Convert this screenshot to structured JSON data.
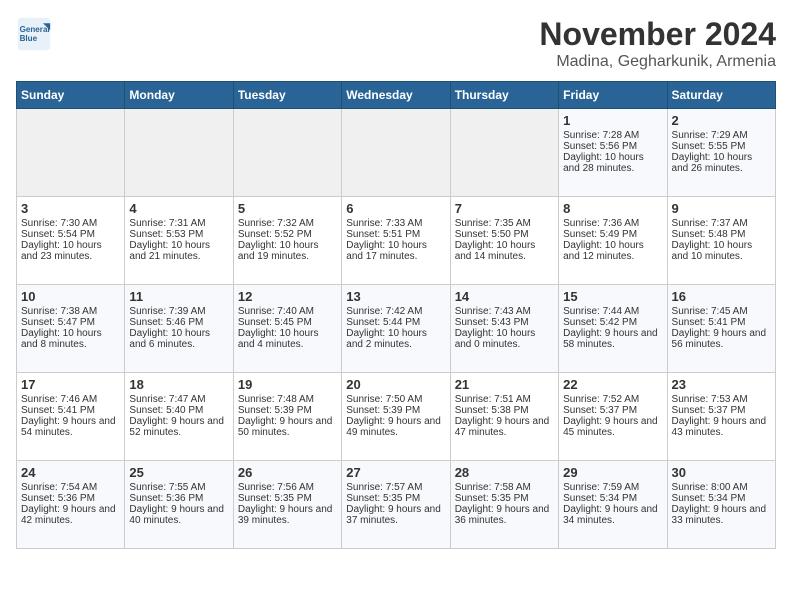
{
  "header": {
    "logo_line1": "General",
    "logo_line2": "Blue",
    "month_year": "November 2024",
    "location": "Madina, Gegharkunik, Armenia"
  },
  "weekdays": [
    "Sunday",
    "Monday",
    "Tuesday",
    "Wednesday",
    "Thursday",
    "Friday",
    "Saturday"
  ],
  "weeks": [
    [
      {
        "day": "",
        "empty": true
      },
      {
        "day": "",
        "empty": true
      },
      {
        "day": "",
        "empty": true
      },
      {
        "day": "",
        "empty": true
      },
      {
        "day": "",
        "empty": true
      },
      {
        "day": "1",
        "sunrise": "7:28 AM",
        "sunset": "5:56 PM",
        "daylight": "10 hours and 28 minutes."
      },
      {
        "day": "2",
        "sunrise": "7:29 AM",
        "sunset": "5:55 PM",
        "daylight": "10 hours and 26 minutes."
      }
    ],
    [
      {
        "day": "3",
        "sunrise": "7:30 AM",
        "sunset": "5:54 PM",
        "daylight": "10 hours and 23 minutes."
      },
      {
        "day": "4",
        "sunrise": "7:31 AM",
        "sunset": "5:53 PM",
        "daylight": "10 hours and 21 minutes."
      },
      {
        "day": "5",
        "sunrise": "7:32 AM",
        "sunset": "5:52 PM",
        "daylight": "10 hours and 19 minutes."
      },
      {
        "day": "6",
        "sunrise": "7:33 AM",
        "sunset": "5:51 PM",
        "daylight": "10 hours and 17 minutes."
      },
      {
        "day": "7",
        "sunrise": "7:35 AM",
        "sunset": "5:50 PM",
        "daylight": "10 hours and 14 minutes."
      },
      {
        "day": "8",
        "sunrise": "7:36 AM",
        "sunset": "5:49 PM",
        "daylight": "10 hours and 12 minutes."
      },
      {
        "day": "9",
        "sunrise": "7:37 AM",
        "sunset": "5:48 PM",
        "daylight": "10 hours and 10 minutes."
      }
    ],
    [
      {
        "day": "10",
        "sunrise": "7:38 AM",
        "sunset": "5:47 PM",
        "daylight": "10 hours and 8 minutes."
      },
      {
        "day": "11",
        "sunrise": "7:39 AM",
        "sunset": "5:46 PM",
        "daylight": "10 hours and 6 minutes."
      },
      {
        "day": "12",
        "sunrise": "7:40 AM",
        "sunset": "5:45 PM",
        "daylight": "10 hours and 4 minutes."
      },
      {
        "day": "13",
        "sunrise": "7:42 AM",
        "sunset": "5:44 PM",
        "daylight": "10 hours and 2 minutes."
      },
      {
        "day": "14",
        "sunrise": "7:43 AM",
        "sunset": "5:43 PM",
        "daylight": "10 hours and 0 minutes."
      },
      {
        "day": "15",
        "sunrise": "7:44 AM",
        "sunset": "5:42 PM",
        "daylight": "9 hours and 58 minutes."
      },
      {
        "day": "16",
        "sunrise": "7:45 AM",
        "sunset": "5:41 PM",
        "daylight": "9 hours and 56 minutes."
      }
    ],
    [
      {
        "day": "17",
        "sunrise": "7:46 AM",
        "sunset": "5:41 PM",
        "daylight": "9 hours and 54 minutes."
      },
      {
        "day": "18",
        "sunrise": "7:47 AM",
        "sunset": "5:40 PM",
        "daylight": "9 hours and 52 minutes."
      },
      {
        "day": "19",
        "sunrise": "7:48 AM",
        "sunset": "5:39 PM",
        "daylight": "9 hours and 50 minutes."
      },
      {
        "day": "20",
        "sunrise": "7:50 AM",
        "sunset": "5:39 PM",
        "daylight": "9 hours and 49 minutes."
      },
      {
        "day": "21",
        "sunrise": "7:51 AM",
        "sunset": "5:38 PM",
        "daylight": "9 hours and 47 minutes."
      },
      {
        "day": "22",
        "sunrise": "7:52 AM",
        "sunset": "5:37 PM",
        "daylight": "9 hours and 45 minutes."
      },
      {
        "day": "23",
        "sunrise": "7:53 AM",
        "sunset": "5:37 PM",
        "daylight": "9 hours and 43 minutes."
      }
    ],
    [
      {
        "day": "24",
        "sunrise": "7:54 AM",
        "sunset": "5:36 PM",
        "daylight": "9 hours and 42 minutes."
      },
      {
        "day": "25",
        "sunrise": "7:55 AM",
        "sunset": "5:36 PM",
        "daylight": "9 hours and 40 minutes."
      },
      {
        "day": "26",
        "sunrise": "7:56 AM",
        "sunset": "5:35 PM",
        "daylight": "9 hours and 39 minutes."
      },
      {
        "day": "27",
        "sunrise": "7:57 AM",
        "sunset": "5:35 PM",
        "daylight": "9 hours and 37 minutes."
      },
      {
        "day": "28",
        "sunrise": "7:58 AM",
        "sunset": "5:35 PM",
        "daylight": "9 hours and 36 minutes."
      },
      {
        "day": "29",
        "sunrise": "7:59 AM",
        "sunset": "5:34 PM",
        "daylight": "9 hours and 34 minutes."
      },
      {
        "day": "30",
        "sunrise": "8:00 AM",
        "sunset": "5:34 PM",
        "daylight": "9 hours and 33 minutes."
      }
    ]
  ]
}
